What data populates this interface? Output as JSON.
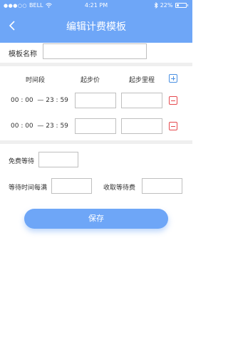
{
  "status_bar": {
    "carrier": "BELL",
    "time": "4:21 PM",
    "battery": "22%"
  },
  "nav": {
    "title": "编辑计费模板"
  },
  "template_name": {
    "label": "模板名称",
    "value": "",
    "placeholder": ""
  },
  "table": {
    "headers": [
      "时间段",
      "起步价",
      "起步里程"
    ],
    "rows": [
      {
        "time": "00 : 00  — 23 : 59",
        "start_price": "",
        "start_mileage": ""
      },
      {
        "time": "00 : 00  — 23 : 59",
        "start_price": "",
        "start_mileage": ""
      }
    ]
  },
  "waiting": {
    "free_wait_label": "免费等待",
    "free_wait_value": "",
    "wait_interval_label": "等待时间每满",
    "wait_interval_value": "",
    "wait_fee_label": "收取等待费",
    "wait_fee_value": ""
  },
  "save_label": "保存",
  "colors": {
    "primary": "#6ea6f7",
    "add_icon": "#4a90e2",
    "remove_icon": "#e5484d",
    "divider": "#efefef"
  }
}
